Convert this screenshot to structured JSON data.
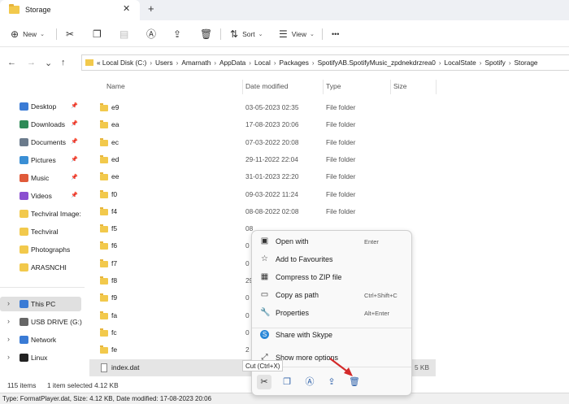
{
  "window": {
    "tab_title": "Storage",
    "close_glyph": "✕",
    "new_tab_glyph": "+"
  },
  "toolbar": {
    "new_label": "New",
    "sort_label": "Sort",
    "view_label": "View",
    "more_glyph": "•••"
  },
  "address": {
    "crumbs": [
      "« Local Disk (C:)",
      "Users",
      "Amarnath",
      "AppData",
      "Local",
      "Packages",
      "SpotifyAB.SpotifyMusic_zpdnekdrzrea0",
      "LocalState",
      "Spotify",
      "Storage"
    ]
  },
  "sidebar": {
    "items": [
      {
        "label": "Desktop",
        "icon": "desktop-icon",
        "color": "#3a7bd5"
      },
      {
        "label": "Downloads",
        "icon": "download-icon",
        "color": "#2e8b57"
      },
      {
        "label": "Documents",
        "icon": "document-icon",
        "color": "#6b7b8c"
      },
      {
        "label": "Pictures",
        "icon": "picture-icon",
        "color": "#3a8fd5"
      },
      {
        "label": "Music",
        "icon": "music-icon",
        "color": "#e05a3a"
      },
      {
        "label": "Videos",
        "icon": "video-icon",
        "color": "#8a4fd0"
      },
      {
        "label": "Techviral Image:",
        "icon": "folder-icon",
        "color": "#f2c94c"
      },
      {
        "label": "Techviral",
        "icon": "folder-icon",
        "color": "#f2c94c"
      },
      {
        "label": "Photographs",
        "icon": "folder-icon",
        "color": "#f2c94c"
      },
      {
        "label": "ARASNCHI",
        "icon": "folder-icon",
        "color": "#f2c94c"
      }
    ],
    "tree": [
      {
        "label": "This PC",
        "icon": "pc-icon",
        "color": "#3a7bd5"
      },
      {
        "label": "USB DRIVE (G:)",
        "icon": "drive-icon",
        "color": "#666666"
      },
      {
        "label": "Network",
        "icon": "network-icon",
        "color": "#3a7bd5"
      },
      {
        "label": "Linux",
        "icon": "linux-icon",
        "color": "#222222"
      }
    ]
  },
  "columns": {
    "name": "Name",
    "date": "Date modified",
    "type": "Type",
    "size": "Size"
  },
  "rows": [
    {
      "name": "e9",
      "date": "03-05-2023 02:35",
      "type": "File folder",
      "size": ""
    },
    {
      "name": "ea",
      "date": "17-08-2023 20:06",
      "type": "File folder",
      "size": ""
    },
    {
      "name": "ec",
      "date": "07-03-2022 20:08",
      "type": "File folder",
      "size": ""
    },
    {
      "name": "ed",
      "date": "29-11-2022 22:04",
      "type": "File folder",
      "size": ""
    },
    {
      "name": "ee",
      "date": "31-01-2023 22:20",
      "type": "File folder",
      "size": ""
    },
    {
      "name": "f0",
      "date": "09-03-2022 11:24",
      "type": "File folder",
      "size": ""
    },
    {
      "name": "f4",
      "date": "08-08-2022 02:08",
      "type": "File folder",
      "size": ""
    },
    {
      "name": "f5",
      "date": "08",
      "type": "",
      "size": ""
    },
    {
      "name": "f6",
      "date": "0",
      "type": "",
      "size": ""
    },
    {
      "name": "f7",
      "date": "0",
      "type": "",
      "size": ""
    },
    {
      "name": "f8",
      "date": "29",
      "type": "",
      "size": ""
    },
    {
      "name": "f9",
      "date": "0",
      "type": "",
      "size": ""
    },
    {
      "name": "fa",
      "date": "0",
      "type": "",
      "size": ""
    },
    {
      "name": "fc",
      "date": "0",
      "type": "",
      "size": ""
    },
    {
      "name": "fe",
      "date": "2",
      "type": "",
      "size": ""
    },
    {
      "name": "index.dat",
      "date": "",
      "type": "",
      "size": "5 KB"
    }
  ],
  "context_menu": {
    "items": [
      {
        "label": "Open with",
        "shortcut": "Enter",
        "icon": "open-with-icon"
      },
      {
        "label": "Add to Favourites",
        "shortcut": "",
        "icon": "star-icon"
      },
      {
        "label": "Compress to ZIP file",
        "shortcut": "",
        "icon": "zip-icon"
      },
      {
        "label": "Copy as path",
        "shortcut": "Ctrl+Shift+C",
        "icon": "copy-path-icon"
      },
      {
        "label": "Properties",
        "shortcut": "Alt+Enter",
        "icon": "wrench-icon"
      },
      {
        "label": "Share with Skype",
        "shortcut": "",
        "icon": "skype-icon"
      },
      {
        "label": "Show more options",
        "shortcut": "",
        "icon": "more-options-icon"
      }
    ],
    "tooltip": "Cut (Ctrl+X)"
  },
  "status": {
    "count": "115 items",
    "selection": "1 item selected  4.12 KB"
  },
  "footer": {
    "text": "Type: FormatPlayer.dat, Size: 4.12 KB, Date modified: 17-08-2023 20:06"
  }
}
